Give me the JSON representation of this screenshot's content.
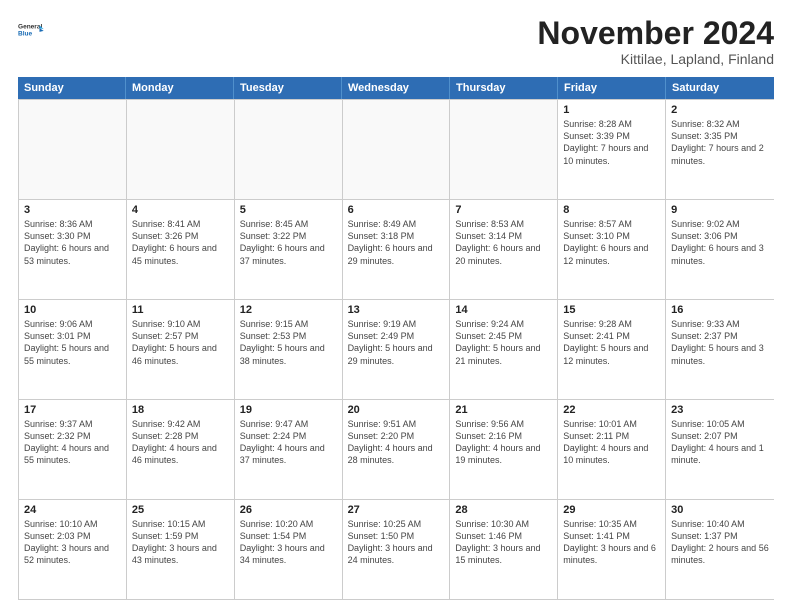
{
  "header": {
    "logo_line1": "General",
    "logo_line2": "Blue",
    "month_title": "November 2024",
    "subtitle": "Kittilae, Lapland, Finland"
  },
  "weekdays": [
    "Sunday",
    "Monday",
    "Tuesday",
    "Wednesday",
    "Thursday",
    "Friday",
    "Saturday"
  ],
  "weeks": [
    [
      {
        "day": "",
        "info": ""
      },
      {
        "day": "",
        "info": ""
      },
      {
        "day": "",
        "info": ""
      },
      {
        "day": "",
        "info": ""
      },
      {
        "day": "",
        "info": ""
      },
      {
        "day": "1",
        "info": "Sunrise: 8:28 AM\nSunset: 3:39 PM\nDaylight: 7 hours\nand 10 minutes."
      },
      {
        "day": "2",
        "info": "Sunrise: 8:32 AM\nSunset: 3:35 PM\nDaylight: 7 hours\nand 2 minutes."
      }
    ],
    [
      {
        "day": "3",
        "info": "Sunrise: 8:36 AM\nSunset: 3:30 PM\nDaylight: 6 hours\nand 53 minutes."
      },
      {
        "day": "4",
        "info": "Sunrise: 8:41 AM\nSunset: 3:26 PM\nDaylight: 6 hours\nand 45 minutes."
      },
      {
        "day": "5",
        "info": "Sunrise: 8:45 AM\nSunset: 3:22 PM\nDaylight: 6 hours\nand 37 minutes."
      },
      {
        "day": "6",
        "info": "Sunrise: 8:49 AM\nSunset: 3:18 PM\nDaylight: 6 hours\nand 29 minutes."
      },
      {
        "day": "7",
        "info": "Sunrise: 8:53 AM\nSunset: 3:14 PM\nDaylight: 6 hours\nand 20 minutes."
      },
      {
        "day": "8",
        "info": "Sunrise: 8:57 AM\nSunset: 3:10 PM\nDaylight: 6 hours\nand 12 minutes."
      },
      {
        "day": "9",
        "info": "Sunrise: 9:02 AM\nSunset: 3:06 PM\nDaylight: 6 hours\nand 3 minutes."
      }
    ],
    [
      {
        "day": "10",
        "info": "Sunrise: 9:06 AM\nSunset: 3:01 PM\nDaylight: 5 hours\nand 55 minutes."
      },
      {
        "day": "11",
        "info": "Sunrise: 9:10 AM\nSunset: 2:57 PM\nDaylight: 5 hours\nand 46 minutes."
      },
      {
        "day": "12",
        "info": "Sunrise: 9:15 AM\nSunset: 2:53 PM\nDaylight: 5 hours\nand 38 minutes."
      },
      {
        "day": "13",
        "info": "Sunrise: 9:19 AM\nSunset: 2:49 PM\nDaylight: 5 hours\nand 29 minutes."
      },
      {
        "day": "14",
        "info": "Sunrise: 9:24 AM\nSunset: 2:45 PM\nDaylight: 5 hours\nand 21 minutes."
      },
      {
        "day": "15",
        "info": "Sunrise: 9:28 AM\nSunset: 2:41 PM\nDaylight: 5 hours\nand 12 minutes."
      },
      {
        "day": "16",
        "info": "Sunrise: 9:33 AM\nSunset: 2:37 PM\nDaylight: 5 hours\nand 3 minutes."
      }
    ],
    [
      {
        "day": "17",
        "info": "Sunrise: 9:37 AM\nSunset: 2:32 PM\nDaylight: 4 hours\nand 55 minutes."
      },
      {
        "day": "18",
        "info": "Sunrise: 9:42 AM\nSunset: 2:28 PM\nDaylight: 4 hours\nand 46 minutes."
      },
      {
        "day": "19",
        "info": "Sunrise: 9:47 AM\nSunset: 2:24 PM\nDaylight: 4 hours\nand 37 minutes."
      },
      {
        "day": "20",
        "info": "Sunrise: 9:51 AM\nSunset: 2:20 PM\nDaylight: 4 hours\nand 28 minutes."
      },
      {
        "day": "21",
        "info": "Sunrise: 9:56 AM\nSunset: 2:16 PM\nDaylight: 4 hours\nand 19 minutes."
      },
      {
        "day": "22",
        "info": "Sunrise: 10:01 AM\nSunset: 2:11 PM\nDaylight: 4 hours\nand 10 minutes."
      },
      {
        "day": "23",
        "info": "Sunrise: 10:05 AM\nSunset: 2:07 PM\nDaylight: 4 hours\nand 1 minute."
      }
    ],
    [
      {
        "day": "24",
        "info": "Sunrise: 10:10 AM\nSunset: 2:03 PM\nDaylight: 3 hours\nand 52 minutes."
      },
      {
        "day": "25",
        "info": "Sunrise: 10:15 AM\nSunset: 1:59 PM\nDaylight: 3 hours\nand 43 minutes."
      },
      {
        "day": "26",
        "info": "Sunrise: 10:20 AM\nSunset: 1:54 PM\nDaylight: 3 hours\nand 34 minutes."
      },
      {
        "day": "27",
        "info": "Sunrise: 10:25 AM\nSunset: 1:50 PM\nDaylight: 3 hours\nand 24 minutes."
      },
      {
        "day": "28",
        "info": "Sunrise: 10:30 AM\nSunset: 1:46 PM\nDaylight: 3 hours\nand 15 minutes."
      },
      {
        "day": "29",
        "info": "Sunrise: 10:35 AM\nSunset: 1:41 PM\nDaylight: 3 hours\nand 6 minutes."
      },
      {
        "day": "30",
        "info": "Sunrise: 10:40 AM\nSunset: 1:37 PM\nDaylight: 2 hours\nand 56 minutes."
      }
    ]
  ]
}
